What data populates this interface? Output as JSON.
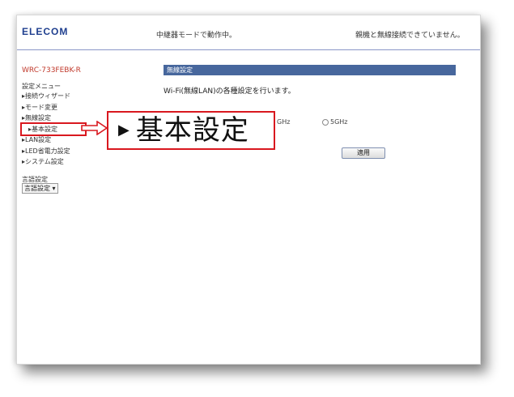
{
  "header": {
    "logo": "ELECOM",
    "mode_status": "中継器モードで動作中。",
    "connection_status": "親機と無線接続できていません。"
  },
  "sidebar": {
    "model": "WRC-733FEBK-R",
    "menu_title": "設定メニュー",
    "items": [
      {
        "label": "▸接続ウィザード"
      },
      {
        "label": "▸モード変更"
      },
      {
        "label": "▸無線設定"
      },
      {
        "label": "▸基本設定"
      },
      {
        "label": "▸LAN設定"
      },
      {
        "label": "▸LED省電力設定"
      },
      {
        "label": "▸システム設定"
      }
    ],
    "language_title": "言語設定",
    "language_select": "言語設定 ▾"
  },
  "main": {
    "section_title": "無線設定",
    "description": "Wi-Fi(無線LAN)の各種設定を行います。",
    "band_option_left": "GHz",
    "band_option_right": "5GHz",
    "apply_label": "適用"
  },
  "callout": {
    "glyph": "▶",
    "text": "基本設定"
  },
  "colors": {
    "accent_red": "#d9181f",
    "brand_blue": "#1f3f8f",
    "section_bar": "#47679d"
  }
}
